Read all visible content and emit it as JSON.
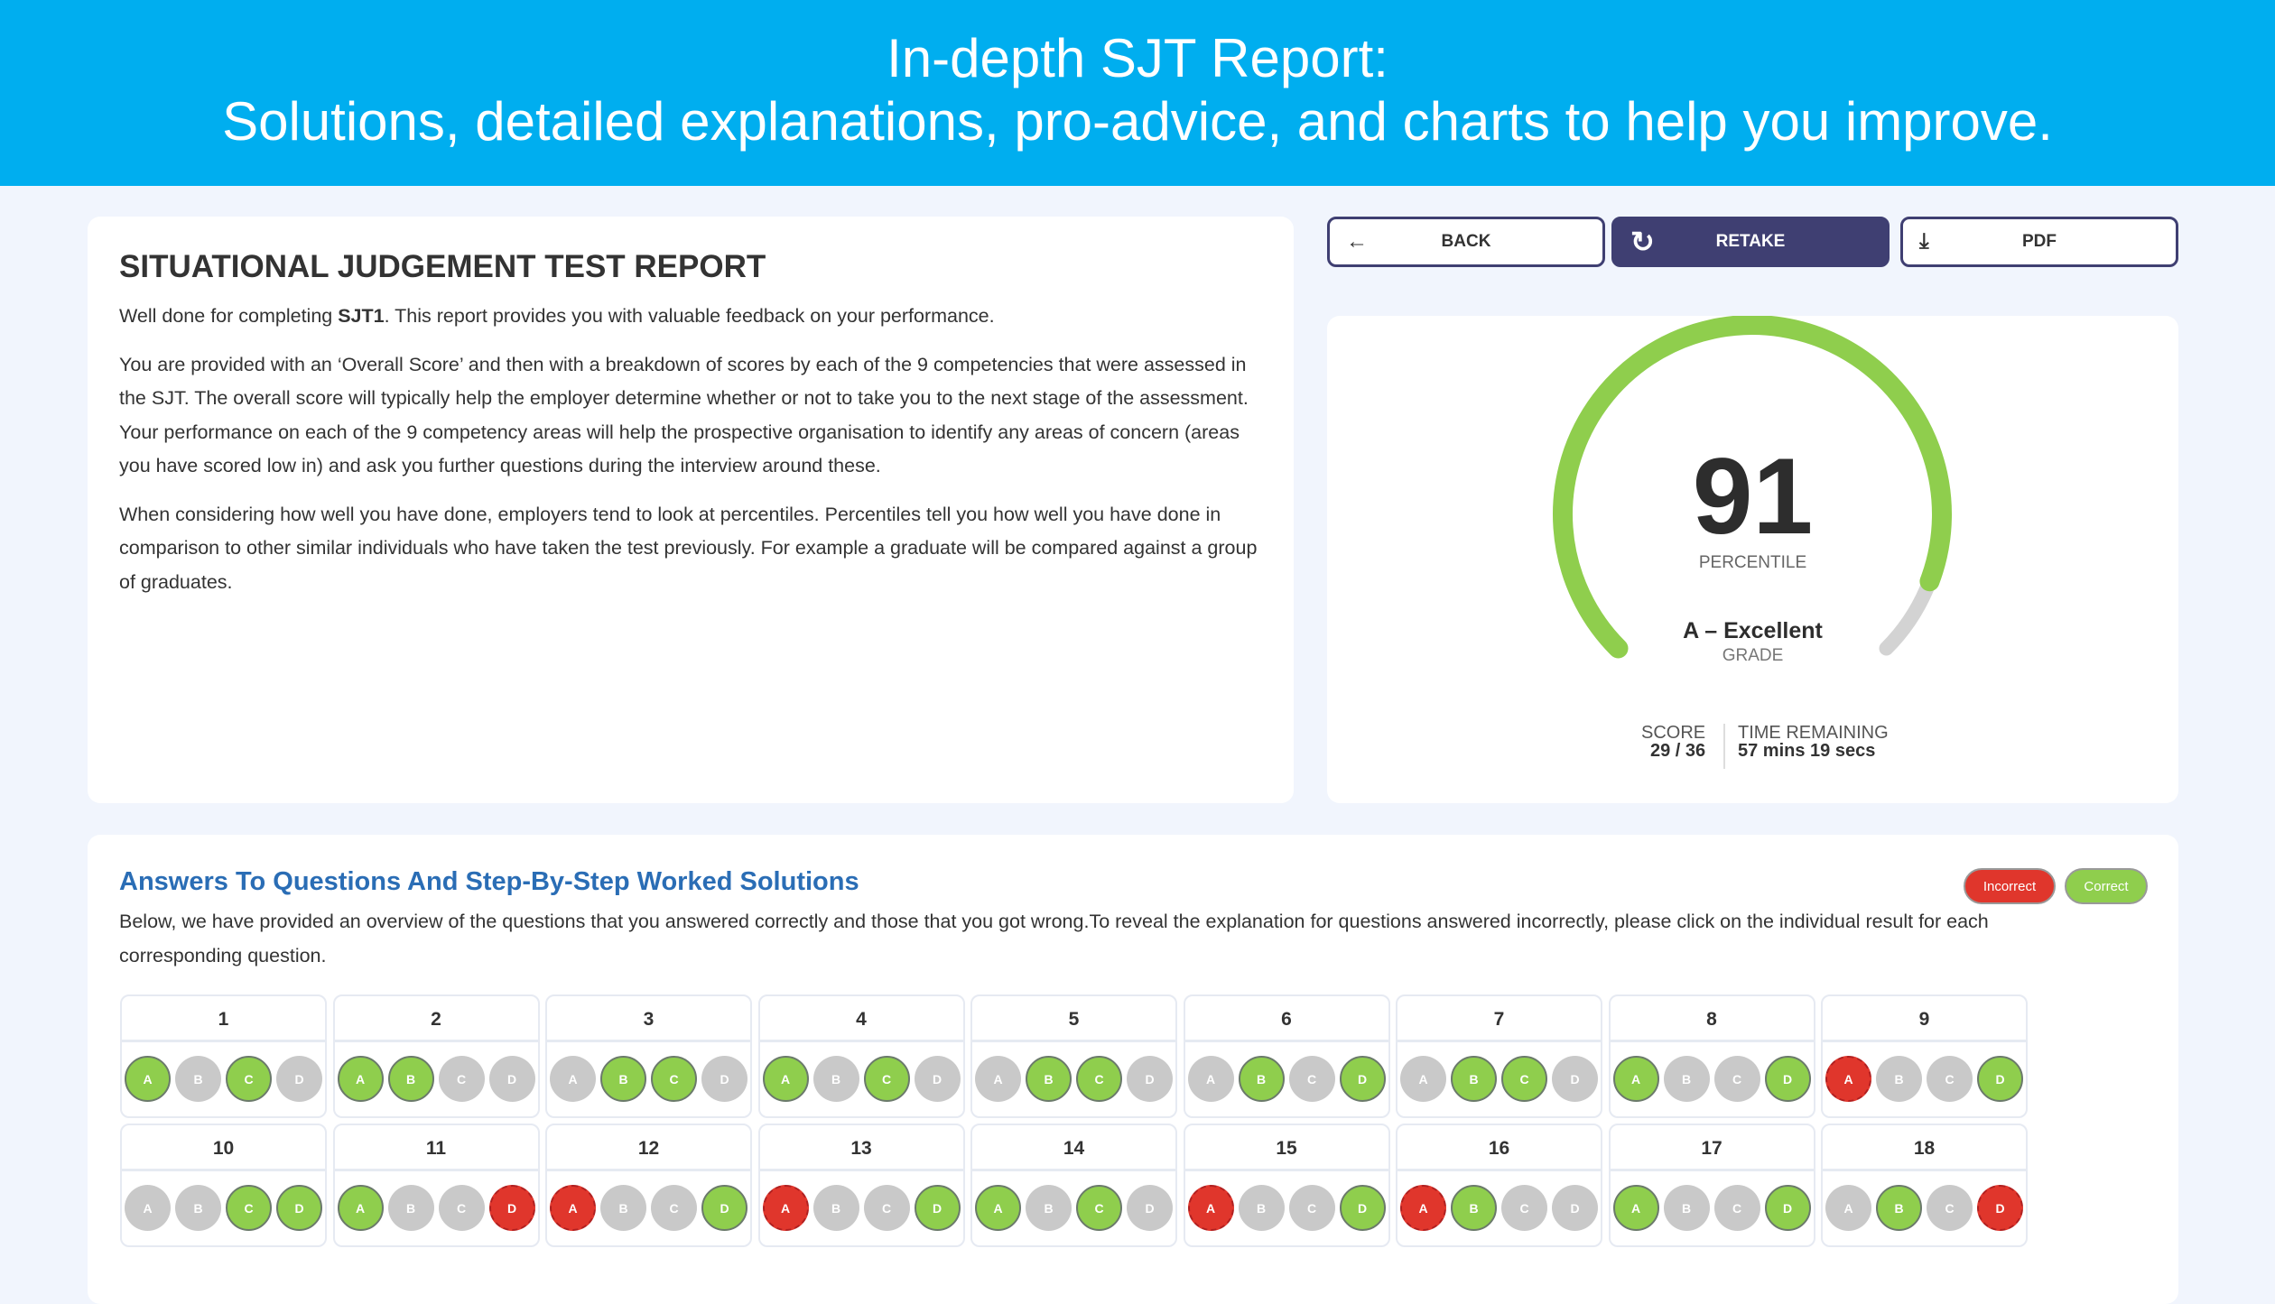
{
  "banner": {
    "line1": "In-depth SJT Report:",
    "line2": "Solutions, detailed explanations, pro-advice, and charts to help you improve."
  },
  "report": {
    "title": "SITUATIONAL JUDGEMENT TEST REPORT",
    "intro_pre": "Well done for completing ",
    "intro_bold": "SJT1",
    "intro_post": ". This report provides you with valuable feedback on your performance.",
    "p2": "You are provided with an ‘Overall Score’ and then with a breakdown of scores by each of the 9 competencies that were assessed in the SJT. The overall score will typically help the employer determine whether or not to take you to the next stage of the assessment. Your performance on each of the 9 competency areas will help the prospective organisation to identify any areas of concern (areas you have scored low in) and ask you further questions during the interview around these.",
    "p3": "When considering how well you have done, employers tend to look at percentiles. Percentiles tell you how well you have done in comparison to other similar individuals who have taken the test previously. For example a graduate will be compared against a group of graduates."
  },
  "buttons": {
    "back": "BACK",
    "retake": "RETAKE",
    "pdf": "PDF"
  },
  "gauge": {
    "value": "91",
    "percent": 91,
    "value_label": "PERCENTILE",
    "grade": "A – Excellent",
    "grade_label": "GRADE",
    "score_label": "SCORE",
    "score": "29 / 36",
    "time_label": "TIME REMAINING",
    "time": "57 mins 19 secs",
    "color": "#8fce4d",
    "track": "#d3d3d3"
  },
  "answers": {
    "title": "Answers To Questions And Step-By-Step Worked Solutions",
    "description": "Below, we have provided an overview of the questions that you answered correctly and those that you got wrong.To reveal the explanation for questions answered incorrectly, please click on the individual result for each corresponding question.",
    "legend_incorrect": "Incorrect",
    "legend_correct": "Correct",
    "options": [
      "A",
      "B",
      "C",
      "D"
    ],
    "questions": [
      {
        "n": "1",
        "s": [
          "correct",
          "none",
          "correct",
          "none"
        ]
      },
      {
        "n": "2",
        "s": [
          "correct",
          "correct",
          "none",
          "none"
        ]
      },
      {
        "n": "3",
        "s": [
          "none",
          "correct",
          "correct",
          "none"
        ]
      },
      {
        "n": "4",
        "s": [
          "correct",
          "none",
          "correct",
          "none"
        ]
      },
      {
        "n": "5",
        "s": [
          "none",
          "correct",
          "correct",
          "none"
        ]
      },
      {
        "n": "6",
        "s": [
          "none",
          "correct",
          "none",
          "correct"
        ]
      },
      {
        "n": "7",
        "s": [
          "none",
          "correct",
          "correct",
          "none"
        ]
      },
      {
        "n": "8",
        "s": [
          "correct",
          "none",
          "none",
          "correct"
        ]
      },
      {
        "n": "9",
        "s": [
          "incorrect",
          "none",
          "none",
          "correct"
        ]
      },
      {
        "n": "10",
        "s": [
          "none",
          "none",
          "correct",
          "correct"
        ]
      },
      {
        "n": "11",
        "s": [
          "correct",
          "none",
          "none",
          "incorrect"
        ]
      },
      {
        "n": "12",
        "s": [
          "incorrect",
          "none",
          "none",
          "correct"
        ]
      },
      {
        "n": "13",
        "s": [
          "incorrect",
          "none",
          "none",
          "correct"
        ]
      },
      {
        "n": "14",
        "s": [
          "correct",
          "none",
          "correct",
          "none"
        ]
      },
      {
        "n": "15",
        "s": [
          "incorrect",
          "none",
          "none",
          "correct"
        ]
      },
      {
        "n": "16",
        "s": [
          "incorrect",
          "correct",
          "none",
          "none"
        ]
      },
      {
        "n": "17",
        "s": [
          "correct",
          "none",
          "none",
          "correct"
        ]
      },
      {
        "n": "18",
        "s": [
          "none",
          "correct",
          "none",
          "incorrect"
        ]
      }
    ]
  },
  "colors": {
    "banner": "#00aeef",
    "correct": "#8fce4d",
    "incorrect": "#e0362c",
    "button": "#3f3f72",
    "heading": "#2a6db5"
  }
}
